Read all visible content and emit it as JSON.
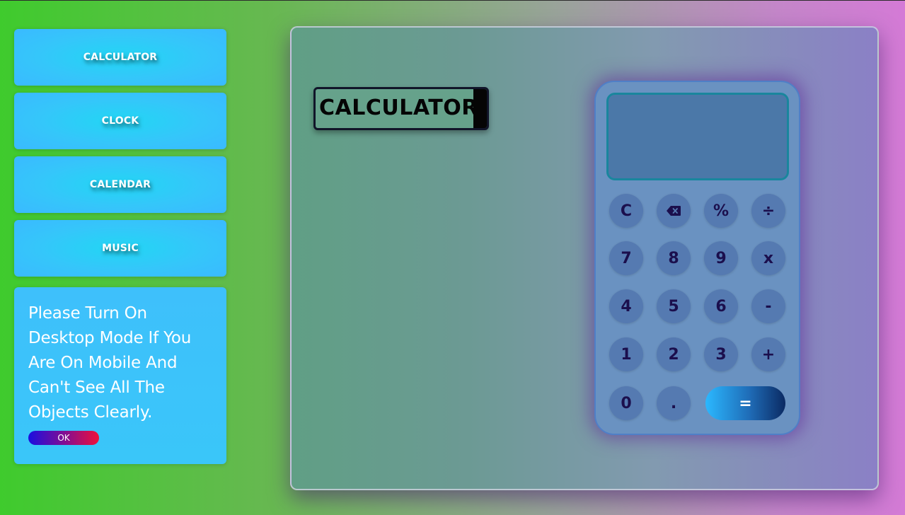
{
  "sidebar": {
    "items": [
      {
        "label": "CALCULATOR"
      },
      {
        "label": "CLOCK"
      },
      {
        "label": "CALENDAR"
      },
      {
        "label": "MUSIC"
      }
    ],
    "notice": {
      "message": "Please Turn On Desktop Mode If You Are On Mobile And Can't See All The Objects Clearly.",
      "ok_label": "OK"
    }
  },
  "main": {
    "title": "CALCULATOR"
  },
  "calculator": {
    "display_value": "",
    "keys": [
      {
        "label": "C",
        "icon": null
      },
      {
        "label": "",
        "icon": "backspace-icon"
      },
      {
        "label": "%",
        "icon": null
      },
      {
        "label": "÷",
        "icon": null
      },
      {
        "label": "7",
        "icon": null
      },
      {
        "label": "8",
        "icon": null
      },
      {
        "label": "9",
        "icon": null
      },
      {
        "label": "x",
        "icon": null
      },
      {
        "label": "4",
        "icon": null
      },
      {
        "label": "5",
        "icon": null
      },
      {
        "label": "6",
        "icon": null
      },
      {
        "label": "-",
        "icon": null
      },
      {
        "label": "1",
        "icon": null
      },
      {
        "label": "2",
        "icon": null
      },
      {
        "label": "3",
        "icon": null
      },
      {
        "label": "+",
        "icon": null
      },
      {
        "label": "0",
        "icon": null
      },
      {
        "label": ".",
        "icon": null
      }
    ],
    "equals_label": "="
  },
  "colors": {
    "key_text": "#1b0f4d",
    "nav_button": "#35c6fa",
    "ok_gradient_start": "#1a0fe0",
    "ok_gradient_end": "#f0103a"
  }
}
